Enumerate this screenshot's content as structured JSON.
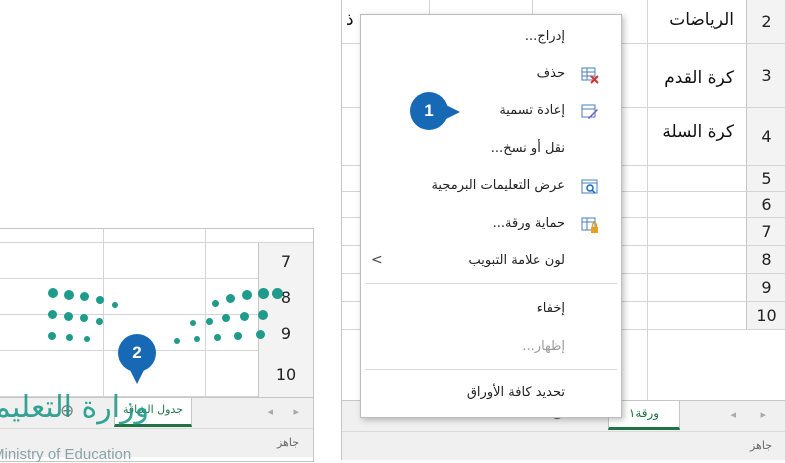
{
  "right_sheet": {
    "partial_header_char": "ذ",
    "rows": [
      {
        "num": "2",
        "text": "الرياضات"
      },
      {
        "num": "3",
        "text": "كرة القدم"
      },
      {
        "num": "4",
        "text": "كرة السلة"
      },
      {
        "num": "5",
        "text": ""
      },
      {
        "num": "6",
        "text": ""
      },
      {
        "num": "7",
        "text": ""
      },
      {
        "num": "8",
        "text": ""
      },
      {
        "num": "9",
        "text": ""
      },
      {
        "num": "10",
        "text": ""
      }
    ],
    "sheet_tab": "ورقة١",
    "add_sheet": "⊕",
    "status": "جاهز"
  },
  "context_menu": {
    "items": [
      {
        "label": "إدراج...",
        "icon": ""
      },
      {
        "label": "حذف",
        "icon": "delete-sheet-icon"
      },
      {
        "label": "إعادة تسمية",
        "icon": "rename-sheet-icon"
      },
      {
        "label": "نقل أو نسخ...",
        "icon": ""
      },
      {
        "label": "عرض التعليمات البرمجية",
        "icon": "view-code-icon"
      },
      {
        "label": "حماية ورقة...",
        "icon": "protect-sheet-icon"
      },
      {
        "label": "لون علامة التبويب",
        "icon": "",
        "submenu_arrow": "<"
      },
      {
        "label": "إخفاء",
        "icon": ""
      },
      {
        "label": "إظهار...",
        "icon": "",
        "disabled": true
      },
      {
        "label": "تحديد كافة الأوراق",
        "icon": ""
      }
    ]
  },
  "callouts": {
    "first": "1",
    "second": "2"
  },
  "left_sheet": {
    "rows": [
      "7",
      "8",
      "9",
      "10"
    ],
    "sheet_tab": "جدول الشاقة",
    "status": "جاهز"
  },
  "watermark": {
    "arabic": "وزارة التعليم",
    "english": "Ministry of Education"
  },
  "colors": {
    "accent": "#1769b6",
    "watermark": "#1e9b8a",
    "active_tab_underline": "#217346"
  }
}
